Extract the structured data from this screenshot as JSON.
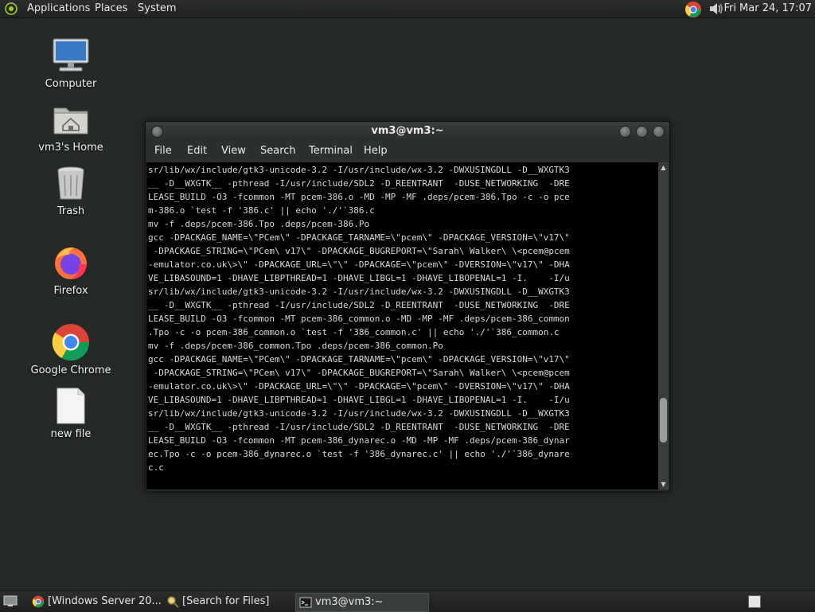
{
  "topbar": {
    "menus": [
      "Applications",
      "Places",
      "System"
    ],
    "clock": "Fri Mar 24, 17:07",
    "tray_icons": [
      "chrome-icon",
      "volume-icon"
    ]
  },
  "desktop": {
    "icons": [
      {
        "label": "Computer",
        "icon": "computer-icon"
      },
      {
        "label": "vm3's Home",
        "icon": "home-folder-icon"
      },
      {
        "label": "Trash",
        "icon": "trash-icon"
      },
      {
        "label": "Firefox",
        "icon": "firefox-icon"
      },
      {
        "label": "Google Chrome",
        "icon": "chrome-icon"
      },
      {
        "label": "new file",
        "icon": "file-icon"
      }
    ]
  },
  "window": {
    "title": "vm3@vm3:~",
    "menu": [
      "File",
      "Edit",
      "View",
      "Search",
      "Terminal",
      "Help"
    ],
    "terminal_lines": [
      "sr/lib/wx/include/gtk3-unicode-3.2 -I/usr/include/wx-3.2 -DWXUSINGDLL -D__WXGTK3",
      "__ -D__WXGTK__ -pthread -I/usr/include/SDL2 -D_REENTRANT  -DUSE_NETWORKING  -DRE",
      "LEASE_BUILD -O3 -fcommon -MT pcem-386.o -MD -MP -MF .deps/pcem-386.Tpo -c -o pce",
      "m-386.o `test -f '386.c' || echo './'`386.c",
      "mv -f .deps/pcem-386.Tpo .deps/pcem-386.Po",
      "gcc -DPACKAGE_NAME=\\\"PCem\\\" -DPACKAGE_TARNAME=\\\"pcem\\\" -DPACKAGE_VERSION=\\\"v17\\\"",
      " -DPACKAGE_STRING=\\\"PCem\\ v17\\\" -DPACKAGE_BUGREPORT=\\\"Sarah\\ Walker\\ \\<pcem@pcem",
      "-emulator.co.uk\\>\\\" -DPACKAGE_URL=\\\"\\\" -DPACKAGE=\\\"pcem\\\" -DVERSION=\\\"v17\\\" -DHA",
      "VE_LIBASOUND=1 -DHAVE_LIBPTHREAD=1 -DHAVE_LIBGL=1 -DHAVE_LIBOPENAL=1 -I.    -I/u",
      "sr/lib/wx/include/gtk3-unicode-3.2 -I/usr/include/wx-3.2 -DWXUSINGDLL -D__WXGTK3",
      "__ -D__WXGTK__ -pthread -I/usr/include/SDL2 -D_REENTRANT  -DUSE_NETWORKING  -DRE",
      "LEASE_BUILD -O3 -fcommon -MT pcem-386_common.o -MD -MP -MF .deps/pcem-386_common",
      ".Tpo -c -o pcem-386_common.o `test -f '386_common.c' || echo './'`386_common.c",
      "mv -f .deps/pcem-386_common.Tpo .deps/pcem-386_common.Po",
      "gcc -DPACKAGE_NAME=\\\"PCem\\\" -DPACKAGE_TARNAME=\\\"pcem\\\" -DPACKAGE_VERSION=\\\"v17\\\"",
      " -DPACKAGE_STRING=\\\"PCem\\ v17\\\" -DPACKAGE_BUGREPORT=\\\"Sarah\\ Walker\\ \\<pcem@pcem",
      "-emulator.co.uk\\>\\\" -DPACKAGE_URL=\\\"\\\" -DPACKAGE=\\\"pcem\\\" -DVERSION=\\\"v17\\\" -DHA",
      "VE_LIBASOUND=1 -DHAVE_LIBPTHREAD=1 -DHAVE_LIBGL=1 -DHAVE_LIBOPENAL=1 -I.    -I/u",
      "sr/lib/wx/include/gtk3-unicode-3.2 -I/usr/include/wx-3.2 -DWXUSINGDLL -D__WXGTK3",
      "__ -D__WXGTK__ -pthread -I/usr/include/SDL2 -D_REENTRANT  -DUSE_NETWORKING  -DRE",
      "LEASE_BUILD -O3 -fcommon -MT pcem-386_dynarec.o -MD -MP -MF .deps/pcem-386_dynar",
      "ec.Tpo -c -o pcem-386_dynarec.o `test -f '386_dynarec.c' || echo './'`386_dynare",
      "c.c"
    ],
    "scroll_position": 0.86
  },
  "taskbar": {
    "tasks": [
      {
        "label": "[Windows Server 20...",
        "icon": "chrome-icon",
        "active": false
      },
      {
        "label": "[Search for Files]",
        "icon": "search-icon",
        "active": false
      },
      {
        "label": "vm3@vm3:~",
        "icon": "terminal-icon",
        "active": true
      }
    ]
  },
  "colors": {
    "desktop_bg": "#262a27",
    "panel_bg": "#1f2220",
    "terminal_bg": "#000000",
    "terminal_fg": "#d9d9d9"
  }
}
